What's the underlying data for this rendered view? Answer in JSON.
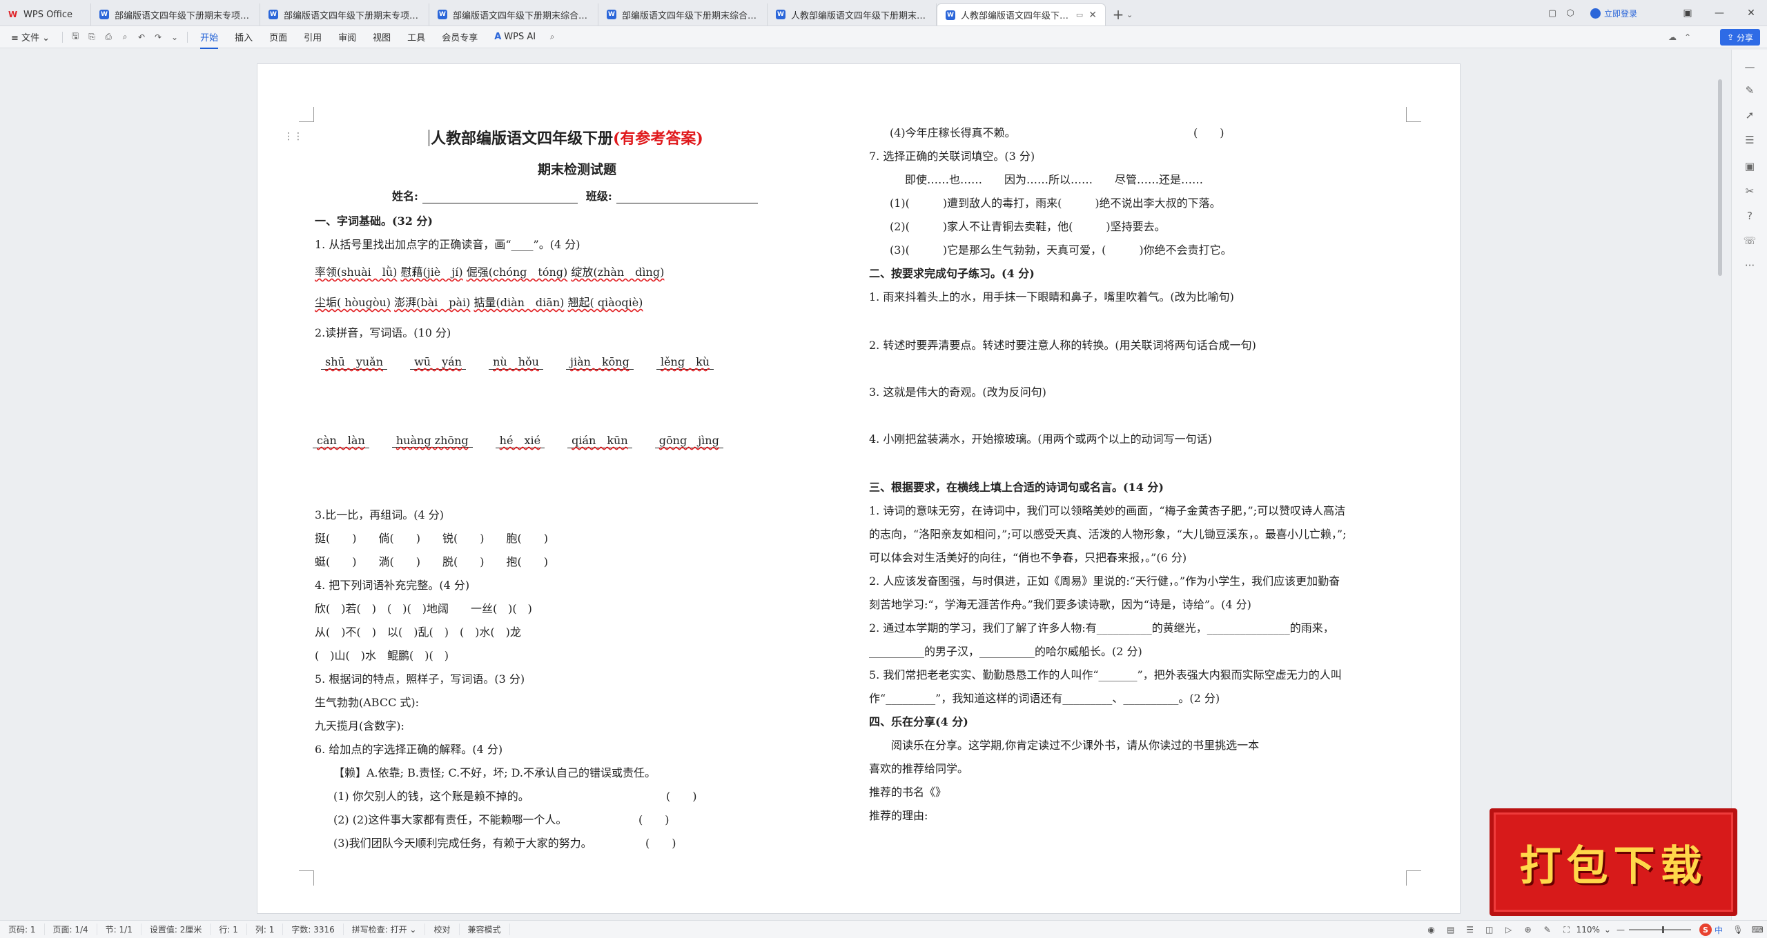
{
  "tabs": {
    "home": "WPS Office",
    "docs": [
      {
        "title": "部编版语文四年级下册期末专项分类",
        "active": false
      },
      {
        "title": "部编版语文四年级下册期末专项分类",
        "active": false
      },
      {
        "title": "部编版语文四年级下册期末综合素质",
        "active": false
      },
      {
        "title": "部编版语文四年级下册期末综合素质",
        "active": false
      },
      {
        "title": "人教部编版语文四年级下册期末检测",
        "active": false
      },
      {
        "title": "人教部编版语文四年级下册期",
        "active": true
      }
    ],
    "new_tab": "+",
    "login": "立即登录"
  },
  "menu": {
    "file": "文件",
    "items": [
      "开始",
      "插入",
      "页面",
      "引用",
      "审阅",
      "视图",
      "工具",
      "会员专享"
    ],
    "active": "开始",
    "ai": "WPS AI",
    "share": "分享"
  },
  "doc": {
    "title": "人教部编版语文四年级下册",
    "title_tag": "(有参考答案)",
    "subtitle": "期末检测试题",
    "name_label": "姓名:",
    "class_label": "班级:",
    "left": {
      "s1": "一、字词基础。(32 分)",
      "q1": "1. 从括号里找出加点字的正确读音，画“____”。(4 分)",
      "q1_l1": [
        "率领(shuài　lǜ)",
        "慰藉(jiè　jí)",
        "倔强(chóng　tóng)",
        "绽放(zhàn　dìng)"
      ],
      "q1_l2": [
        "尘垢( hòugòu)",
        "澎湃(bài　pài)",
        "掂量(diàn　diān)",
        "翘起( qiàoqiè)"
      ],
      "q2": "2.读拼音，写词语。(10 分)",
      "py_row1": [
        "shū　yuǎn",
        "wū　yán",
        "nù　hǒu",
        "jiàn　kōng",
        "lěng　kù"
      ],
      "py_row2": [
        "càn　làn",
        "huàng zhōng",
        "hé　xié",
        "qián　kūn",
        "gōng　jìng"
      ],
      "q3": "3.比一比，再组词。(4 分)",
      "q3_l1": "挺(　　)　　倘(　　)　　锐(　　)　　胞(　　)",
      "q3_l2": "蜓(　　)　　淌(　　)　　脱(　　)　　抱(　　)",
      "q4": "4. 把下列词语补充完整。(4 分)",
      "q4_l1": "欣(　)若(　)　(　)(　)地阔　　一丝(　)(　)",
      "q4_l2": "从(　)不(　)　以(　)乱(　)　(　)水(　)龙",
      "q4_l3": "(　)山(　)水　鲲鹏(　)(　)",
      "q5": "5. 根据词的特点，照样子，写词语。(3 分)",
      "q5_l1": "生气勃勃(ABCC 式):",
      "q5_l2": "九天揽月(含数字):",
      "q6": "6. 给加点的字选择正确的解释。(4 分)",
      "q6_def": "【赖】A.依靠; B.责怪; C.不好，坏; D.不承认自己的错误或责任。",
      "q6_l1": "(1) 你欠别人的钱，这个账是赖不掉的。",
      "q6_l2": "(2) (2)这件事大家都有责任，不能赖哪一个人。",
      "q6_l3": "(3)我们团队今天顺利完成任务，有赖于大家的努力。",
      "paren": "(　　)"
    },
    "right": {
      "q6_l4": "(4)今年庄稼长得真不赖。",
      "q7": "7. 选择正确的关联词填空。(3 分)",
      "q7_opts": "即使……也……　　因为……所以……　　尽管……还是……",
      "q7_l1": "(1)(　　　)遭到敌人的毒打，雨来(　　　)绝不说出李大叔的下落。",
      "q7_l2": "(2)(　　　)家人不让青铜去卖鞋，他(　　　)坚持要去。",
      "q7_l3": "(3)(　　　)它是那么生气勃勃，天真可爱，(　　　)你绝不会责打它。",
      "s2": "二、按要求完成句子练习。(4 分)",
      "s2_q1": "1. 雨来抖着头上的水，用手抹一下眼睛和鼻子，嘴里吹着气。(改为比喻句)",
      "s2_q2": "2. 转述时要弄清要点。转述时要注意人称的转换。(用关联词将两句话合成一句)",
      "s2_q3": "3. 这就是伟大的奇观。(改为反问句)",
      "s2_q4": "4. 小刚把盆装满水，开始擦玻璃。(用两个或两个以上的动词写一句话)",
      "s3": "三、根据要求，在横线上填上合适的诗词句或名言。(14 分)",
      "s3_q1a": "1. 诗词的意味无穷，在诗词中，我们可以领略美妙的画面，“梅子金黄杏子肥，”;可以赞叹诗人高洁",
      "s3_q1b": "的志向，“洛阳亲友如相问，”;可以感受天真、活泼的人物形象，“大儿锄豆溪东，。最喜小儿亡赖，”;",
      "s3_q1c": "可以体会对生活美好的向往，“俏也不争春，只把春来报，。”(6 分)",
      "s3_q2a": "2. 人应该发奋图强，与时俱进，正如《周易》里说的:“天行健，。”作为小学生，我们应该更加勤奋",
      "s3_q2b": "刻苦地学习:“，学海无涯苦作舟。”我们要多读诗歌，因为“诗是，诗给”。(4 分)",
      "s3_q3a": "2. 通过本学期的学习，我们了解了许多人物:有__________的黄继光，_______________的雨来，",
      "s3_q3b": "__________的男子汉，__________的哈尔威船长。(2 分)",
      "s3_q4a": "5. 我们常把老老实实、勤勤恳恳工作的人叫作“_______”，把外表强大内狠而实际空虚无力的人叫",
      "s3_q4b": "作“_________”，我知道这样的词语还有_________、__________。(2 分)",
      "s4": "四、乐在分享(4 分)",
      "s4_l1": "　　阅读乐在分享。这学期,你肯定读过不少课外书，请从你读过的书里挑选一本",
      "s4_l2": "喜欢的推荐给同学。",
      "s4_l3": "推荐的书名《》",
      "s4_l4": "推荐的理由:"
    }
  },
  "status": {
    "page_no": "页码: 1",
    "pages": "页面: 1/4",
    "section": "节: 1/1",
    "setting": "设置值: 2厘米",
    "row": "行: 1",
    "colnum": "列: 1",
    "words": "字数: 3316",
    "spell": "拼写检查: 打开",
    "proof": "校对",
    "compat": "兼容模式",
    "zoom": "110%",
    "ime": "中"
  },
  "banner": {
    "text": "打包下载"
  }
}
